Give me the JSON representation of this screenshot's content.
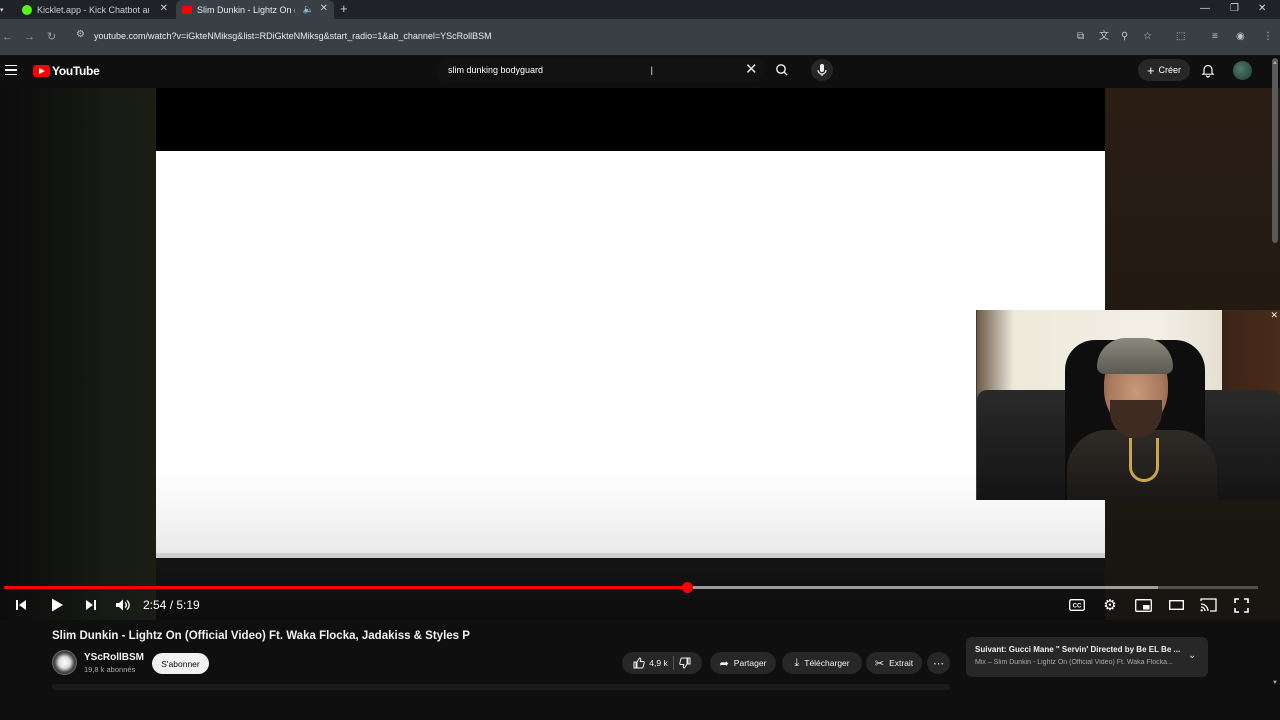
{
  "browser": {
    "tabs": [
      {
        "title": "Kicklet.app - Kick Chatbot and",
        "favicon_color": "#53fc18",
        "active": false
      },
      {
        "title": "Slim Dunkin - Lightz On (Of",
        "favicon_color": "#ff0000",
        "active": true
      }
    ],
    "url": "youtube.com/watch?v=iGkteNMiksg&list=RDiGkteNMiksg&start_radio=1&ab_channel=YScRollBSM"
  },
  "youtube": {
    "logo_text": "YouTube",
    "search": {
      "query": "slim dunking bodyguard"
    },
    "create_label": "Créer"
  },
  "player": {
    "current_time": "2:54",
    "duration": "5:19",
    "time_display": "2:54 / 5:19",
    "progress_fraction": 0.545,
    "buffered_fraction": 0.92,
    "accent_color": "#ff0000"
  },
  "video": {
    "title": "Slim Dunkin - Lightz On (Official Video) Ft. Waka Flocka, Jadakiss & Styles P",
    "channel": {
      "name": "YScRollBSM",
      "subscribers": "19,8 k abonnés"
    },
    "subscribe_label": "S'abonner",
    "likes": "4,9 k",
    "share_label": "Partager",
    "download_label": "Télécharger",
    "clip_label": "Extrait"
  },
  "up_next": {
    "line1": "Suivant: Gucci Mane \" Servin' Directed by Be EL Be ...",
    "line2": "Mix – Slim Dunkin - Lightz On (Official Video) Ft. Waka Flocka..."
  }
}
